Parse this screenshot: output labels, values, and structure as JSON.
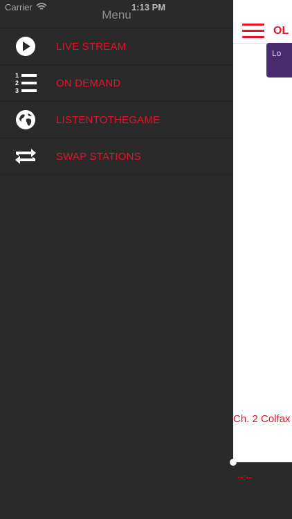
{
  "status_bar": {
    "carrier": "Carrier",
    "time": "1:13 PM"
  },
  "menu": {
    "title": "Menu",
    "items": [
      {
        "label": "LIVE STREAM",
        "icon": "play-circle-icon"
      },
      {
        "label": "ON DEMAND",
        "icon": "numbered-list-icon"
      },
      {
        "label": "LISTENTOTHEGAME",
        "icon": "globe-icon"
      },
      {
        "label": "SWAP STATIONS",
        "icon": "swap-arrows-icon"
      }
    ]
  },
  "panel": {
    "title": "OL",
    "ad_text": "Lo",
    "channel": "Ch. 2 Colfax",
    "timecode": "--:--"
  },
  "colors": {
    "accent": "#e8102a",
    "menu_bg": "#2a2a2a",
    "panel_bg": "#ffffff",
    "ad_bg": "#4a2a6e"
  }
}
